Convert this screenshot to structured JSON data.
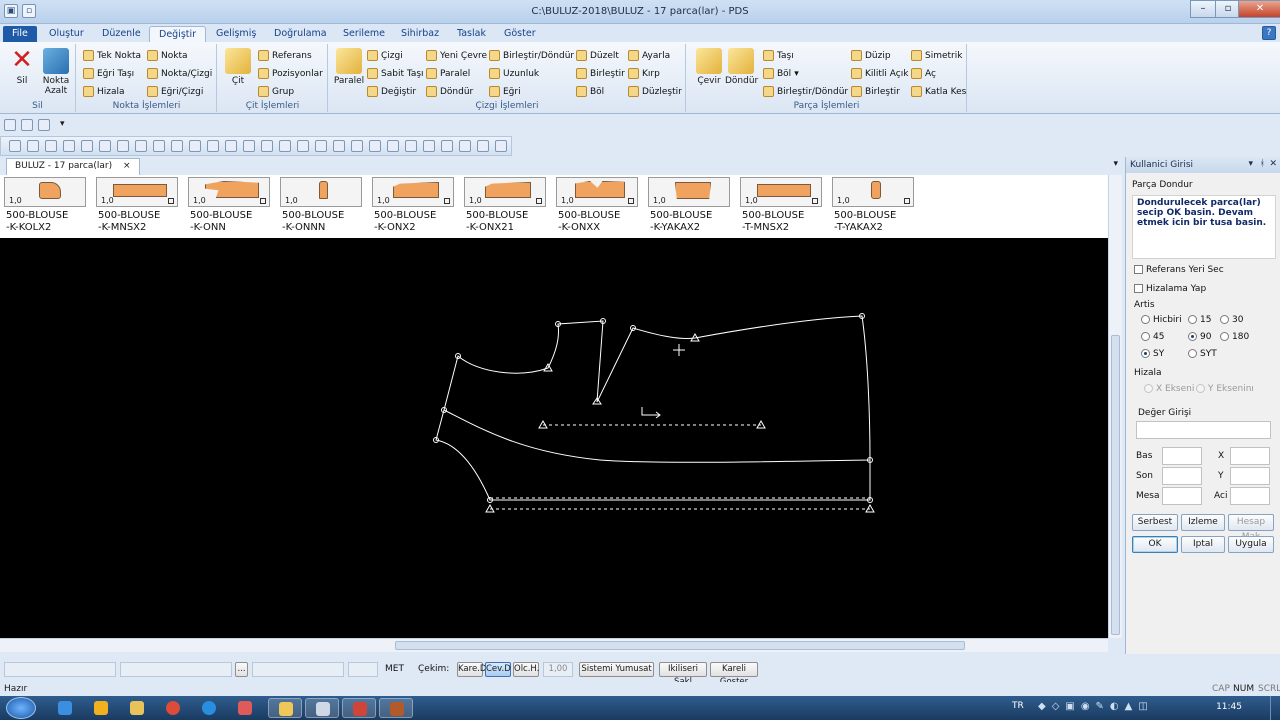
{
  "window": {
    "title": "C:\\BULUZ-2018\\BULUZ  -  17 parca(lar) - PDS"
  },
  "menu": {
    "tabs": [
      "File",
      "Oluştur",
      "Düzenle",
      "Değiştir",
      "Gelişmiş",
      "Doğrulama",
      "Serileme",
      "Sihirbaz",
      "Taslak",
      "Göster"
    ],
    "active": "Değiştir"
  },
  "ribbon": {
    "groups": {
      "sil": {
        "label": "Sil",
        "sil_button": "Sil",
        "nokta_azalt_1": "Nokta",
        "nokta_azalt_2": "Azalt"
      },
      "nokta": {
        "label": "Nokta İşlemleri",
        "items": [
          "Tek Nokta",
          "Eğri Taşı",
          "Hizala",
          "Nokta",
          "Nokta/Çizgi",
          "Eğri/Çizgi"
        ]
      },
      "cit": {
        "label": "Çit İşlemleri",
        "big": "Çit",
        "items": [
          "Referans",
          "Pozisyonlar",
          "Grup"
        ]
      },
      "cizgi": {
        "label": "Çizgi İşlemleri",
        "big": "Paralel",
        "items": [
          "Çizgi",
          "Sabit Taşı",
          "Değiştir",
          "Yeni Çevre",
          "Paralel",
          "Döndür",
          "Birleştir/Döndür",
          "Uzunluk",
          "Eğri",
          "Düzelt",
          "Birleştir",
          "Böl",
          "Ayarla",
          "Kırp",
          "Düzleştir"
        ]
      },
      "parca": {
        "label": "Parça İşlemleri",
        "big1": "Çevir",
        "big2": "Döndür",
        "items": [
          "Taşı",
          "Böl",
          "Birleştir/Döndür",
          "Düzip",
          "Kilitli Açık",
          "Birleştir",
          "Simetrik",
          "Aç",
          "Katla Kes"
        ]
      }
    }
  },
  "document": {
    "tab_label": "BULUZ  -  17 parca(lar)",
    "close": "×"
  },
  "pieces": [
    {
      "scale": "1,0",
      "label": "500-BLOUSE\n-K-KOLX2"
    },
    {
      "scale": "1,0",
      "label": "500-BLOUSE\n-K-MNSX2"
    },
    {
      "scale": "1,0",
      "label": "500-BLOUSE\n-K-ONN"
    },
    {
      "scale": "1,0",
      "label": "500-BLOUSE\n-K-ONNN"
    },
    {
      "scale": "1,0",
      "label": "500-BLOUSE\n-K-ONX2"
    },
    {
      "scale": "1,0",
      "label": "500-BLOUSE\n-K-ONX21"
    },
    {
      "scale": "1,0",
      "label": "500-BLOUSE\n-K-ONXX"
    },
    {
      "scale": "1,0",
      "label": "500-BLOUSE\n-K-YAKAX2"
    },
    {
      "scale": "1,0",
      "label": "500-BLOUSE\n-T-MNSX2"
    },
    {
      "scale": "1,0",
      "label": "500-BLOUSE\n-T-YAKAX2"
    }
  ],
  "panel": {
    "title": "Kullanici Girisi",
    "subtitle": "Parça Dondur",
    "instruction": "Dondurulecek parca(lar) secip OK basin. Devam etmek icin bir tusa basin.",
    "referans": "Referans Yeri Sec",
    "hizalama": "Hizalama Yap",
    "artis_label": "Artis",
    "artis_options": [
      "Hicbiri",
      "15",
      "30",
      "45",
      "90",
      "180",
      "SY",
      "SYT"
    ],
    "artis_selected": [
      "90",
      "SY"
    ],
    "hizala_label": "Hizala",
    "hizala_x": "X Ekseni",
    "hizala_y": "Y Ekseninı",
    "deger_label": "Değer Girişi",
    "bas": "Bas",
    "son": "Son",
    "mesa": "Mesa",
    "x": "X",
    "y": "Y",
    "aci": "Aci",
    "btn_serbest": "Serbest",
    "btn_izleme": "Izleme",
    "btn_hesap": "Hesap Mak",
    "btn_ok": "OK",
    "btn_iptal": "Iptal",
    "btn_uygula": "Uygula"
  },
  "status": {
    "units": "MET",
    "cekim": "Çekim:",
    "buttons": [
      "Kare.D",
      "Cev.D",
      "Olc.H."
    ],
    "active_button": "Cev.D",
    "value": "1,00",
    "sistemi": "Sistemi Yumusat",
    "ikiliseri": "Ikiliseri Sakl",
    "kareli": "Kareli Goster",
    "dots": "...",
    "ready": "Hazır",
    "indicators": [
      "CAP",
      "NUM",
      "SCRL"
    ]
  },
  "taskbar": {
    "lang": "TR",
    "time": "11:45"
  },
  "colors": {
    "accent": "#1f5aa8",
    "piece_fill": "#f0a35e",
    "canvas": "#000000",
    "pattern_line": "#ffffff"
  }
}
